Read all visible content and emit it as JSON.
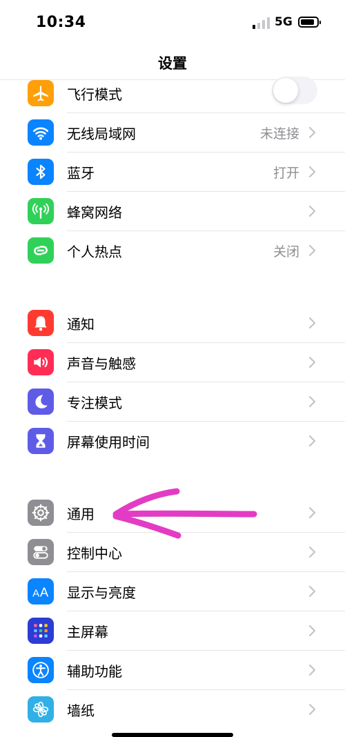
{
  "status": {
    "time": "10:34",
    "network": "5G",
    "signal_bars": 1,
    "battery_level": 0.85
  },
  "nav": {
    "title": "设置"
  },
  "colors": {
    "accent_arrow": "#e33cc4"
  },
  "groups": [
    [
      {
        "name": "airplane",
        "label": "飞行模式",
        "value": "",
        "icon": "airplane-icon",
        "color": "#ff9f0a",
        "toggle": true,
        "toggle_on": false
      },
      {
        "name": "wifi",
        "label": "无线局域网",
        "value": "未连接",
        "icon": "wifi-icon",
        "color": "#0a84ff"
      },
      {
        "name": "bluetooth",
        "label": "蓝牙",
        "value": "打开",
        "icon": "bluetooth-icon",
        "color": "#0a84ff"
      },
      {
        "name": "cellular",
        "label": "蜂窝网络",
        "value": "",
        "icon": "antenna-icon",
        "color": "#30d158"
      },
      {
        "name": "hotspot",
        "label": "个人热点",
        "value": "关闭",
        "icon": "link-icon",
        "color": "#30d158"
      }
    ],
    [
      {
        "name": "notifications",
        "label": "通知",
        "value": "",
        "icon": "bell-icon",
        "color": "#ff3b30"
      },
      {
        "name": "sounds",
        "label": "声音与触感",
        "value": "",
        "icon": "speaker-icon",
        "color": "#ff2d55"
      },
      {
        "name": "focus",
        "label": "专注模式",
        "value": "",
        "icon": "moon-icon",
        "color": "#5e5ce6"
      },
      {
        "name": "screen-time",
        "label": "屏幕使用时间",
        "value": "",
        "icon": "hourglass-icon",
        "color": "#5e5ce6"
      }
    ],
    [
      {
        "name": "general",
        "label": "通用",
        "value": "",
        "icon": "gear-icon",
        "color": "#8e8e93"
      },
      {
        "name": "control-center",
        "label": "控制中心",
        "value": "",
        "icon": "switches-icon",
        "color": "#8e8e93"
      },
      {
        "name": "display",
        "label": "显示与亮度",
        "value": "",
        "icon": "text-size-icon",
        "color": "#0a84ff"
      },
      {
        "name": "home-screen",
        "label": "主屏幕",
        "value": "",
        "icon": "grid-icon",
        "color": "#2c3cd4"
      },
      {
        "name": "accessibility",
        "label": "辅助功能",
        "value": "",
        "icon": "accessibility-icon",
        "color": "#0a84ff"
      },
      {
        "name": "wallpaper",
        "label": "墙纸",
        "value": "",
        "icon": "flower-icon",
        "color": "#30b0e6"
      }
    ]
  ]
}
